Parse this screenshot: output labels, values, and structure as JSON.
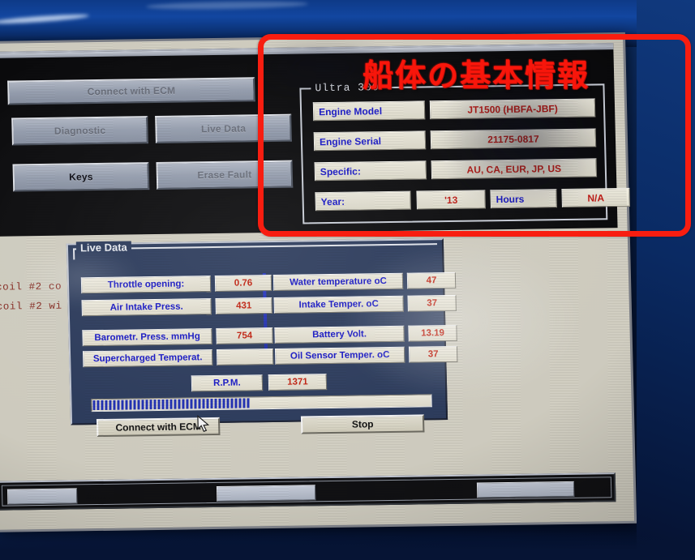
{
  "annotation": {
    "title": "船体の基本情報",
    "box_color": "#f81d10"
  },
  "app_window": {
    "buttons": [
      {
        "label": "Connect with ECM",
        "state": "disabled"
      },
      {
        "label": "Diagnostic",
        "state": "disabled"
      },
      {
        "label": "Live Data",
        "state": "disabled"
      },
      {
        "label": "Keys",
        "state": "enabled"
      },
      {
        "label": "Erase Fault",
        "state": "disabled"
      }
    ],
    "info_group": {
      "legend": "Ultra 300",
      "rows": [
        {
          "label": "Engine Model",
          "value": "JT1500 (HBFA-JBF)"
        },
        {
          "label": "Engine Serial",
          "value": "21175-0817"
        },
        {
          "label": "Specific:",
          "value": "AU, CA, EUR, JP, US"
        }
      ],
      "year_row": {
        "year_label": "Year:",
        "year_value": "'13",
        "hours_label": "Hours",
        "hours_value": "N/A"
      }
    }
  },
  "live_data": {
    "legend": "Live Data",
    "left_column": [
      {
        "label": "Throttle opening:",
        "value": "0.76"
      },
      {
        "label": "Air Intake Press.",
        "value": "431"
      },
      {
        "label": "Barometr. Press. mmHg",
        "value": "754"
      },
      {
        "label": "Supercharged Temperat.",
        "value": ""
      }
    ],
    "right_column": [
      {
        "label": "Water temperature oC",
        "value": "47"
      },
      {
        "label": "Intake Temper. oC",
        "value": "37"
      },
      {
        "label": "Battery Volt.",
        "value": "13.19"
      },
      {
        "label": "Oil Sensor Temper. oC",
        "value": "37"
      }
    ],
    "rpm": {
      "label": "R.P.M.",
      "value": "1371"
    },
    "progress_percent": 47,
    "buttons": {
      "connect": "Connect with ECM",
      "stop": "Stop"
    }
  },
  "background_text": {
    "line1": "coil #2 co",
    "line2": "coil #2 wi"
  },
  "colors": {
    "label_blue": "#1717cc",
    "value_red": "#c8210f",
    "panel_navy": "#2c3c5e",
    "field_cream": "#f2efe2",
    "annotation_red": "#f81d10"
  }
}
